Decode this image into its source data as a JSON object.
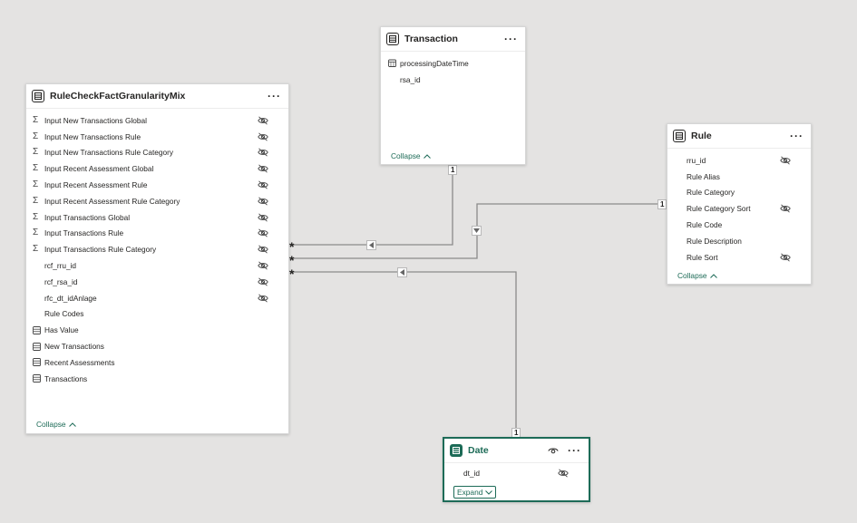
{
  "tables": {
    "rule_check": {
      "title": "RuleCheckFactGranularityMix",
      "collapse_label": "Collapse",
      "fields": [
        {
          "label": "Input New Transactions Global",
          "icon": "sigma-icon",
          "hidden": true
        },
        {
          "label": "Input New Transactions Rule",
          "icon": "sigma-icon",
          "hidden": true
        },
        {
          "label": "Input New Transactions Rule Category",
          "icon": "sigma-icon",
          "hidden": true
        },
        {
          "label": "Input Recent Assessment Global",
          "icon": "sigma-icon",
          "hidden": true
        },
        {
          "label": "Input Recent Assessment Rule",
          "icon": "sigma-icon",
          "hidden": true
        },
        {
          "label": "Input Recent Assessment Rule Category",
          "icon": "sigma-icon",
          "hidden": true
        },
        {
          "label": "Input Transactions Global",
          "icon": "sigma-icon",
          "hidden": true
        },
        {
          "label": "Input Transactions Rule",
          "icon": "sigma-icon",
          "hidden": true
        },
        {
          "label": "Input Transactions Rule Category",
          "icon": "sigma-icon",
          "hidden": true
        },
        {
          "label": "rcf_rru_id",
          "icon": "",
          "hidden": true
        },
        {
          "label": "rcf_rsa_id",
          "icon": "",
          "hidden": true
        },
        {
          "label": "rfc_dt_idAnlage",
          "icon": "",
          "hidden": true
        },
        {
          "label": "Rule Codes",
          "icon": "",
          "hidden": false
        },
        {
          "label": "Has Value",
          "icon": "measure-table-icon",
          "hidden": false
        },
        {
          "label": "New Transactions",
          "icon": "measure-table-icon",
          "hidden": false
        },
        {
          "label": "Recent Assessments",
          "icon": "measure-table-icon",
          "hidden": false
        },
        {
          "label": "Transactions",
          "icon": "measure-table-icon",
          "hidden": false
        }
      ]
    },
    "transaction": {
      "title": "Transaction",
      "collapse_label": "Collapse",
      "fields": [
        {
          "label": "processingDateTime",
          "icon": "calendar-icon",
          "hidden": false
        },
        {
          "label": "rsa_id",
          "icon": "",
          "hidden": false
        }
      ]
    },
    "rule": {
      "title": "Rule",
      "collapse_label": "Collapse",
      "fields": [
        {
          "label": "rru_id",
          "icon": "",
          "hidden": true
        },
        {
          "label": "Rule Alias",
          "icon": "",
          "hidden": false
        },
        {
          "label": "Rule Category",
          "icon": "",
          "hidden": false
        },
        {
          "label": "Rule Category Sort",
          "icon": "",
          "hidden": true
        },
        {
          "label": "Rule Code",
          "icon": "",
          "hidden": false
        },
        {
          "label": "Rule Description",
          "icon": "",
          "hidden": false
        },
        {
          "label": "Rule Sort",
          "icon": "",
          "hidden": true
        }
      ]
    },
    "date": {
      "title": "Date",
      "expand_label": "Expand",
      "fields": [
        {
          "label": "dt_id",
          "icon": "",
          "hidden": true
        }
      ]
    }
  },
  "relationships": {
    "one": "1",
    "many": "*"
  },
  "colors": {
    "accent": "#1d6b57",
    "canvas": "#e4e3e2",
    "line": "#8a8a8a"
  }
}
